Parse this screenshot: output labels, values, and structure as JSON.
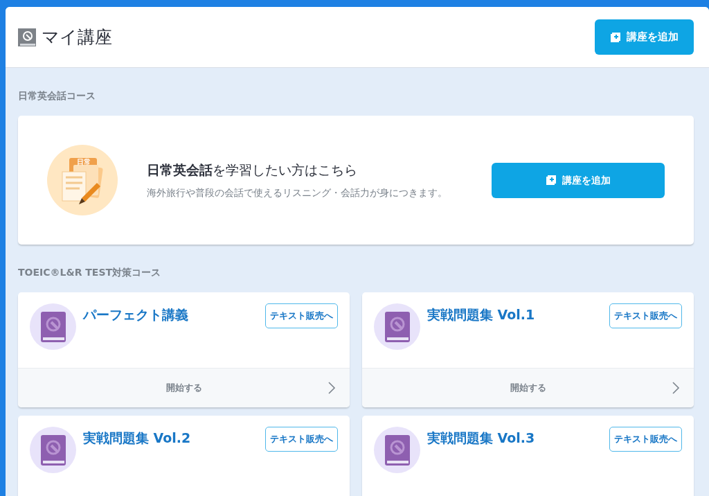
{
  "header": {
    "title": "マイ講座",
    "add_button": "講座を追加"
  },
  "sections": [
    {
      "title": "日常英会話コース",
      "kind": "promo",
      "promo": {
        "illustration_label": "日常",
        "headline": "**日常英会話**を学習したい方はこちら",
        "description": "海外旅行や普段の会話で使えるリスニング・会話力が身につきます。",
        "button": "講座を追加"
      }
    },
    {
      "title": "TOEIC®L&R TEST対策コース",
      "kind": "courses",
      "courses": [
        {
          "title": "パーフェクト講義",
          "shop_button": "テキスト販売へ",
          "start_label": "開始する"
        },
        {
          "title": "実戦問題集 Vol.1",
          "shop_button": "テキスト販売へ",
          "start_label": "開始する"
        },
        {
          "title": "実戦問題集 Vol.2",
          "shop_button": "テキスト販売へ"
        },
        {
          "title": "実戦問題集 Vol.3",
          "shop_button": "テキスト販売へ"
        }
      ]
    }
  ]
}
